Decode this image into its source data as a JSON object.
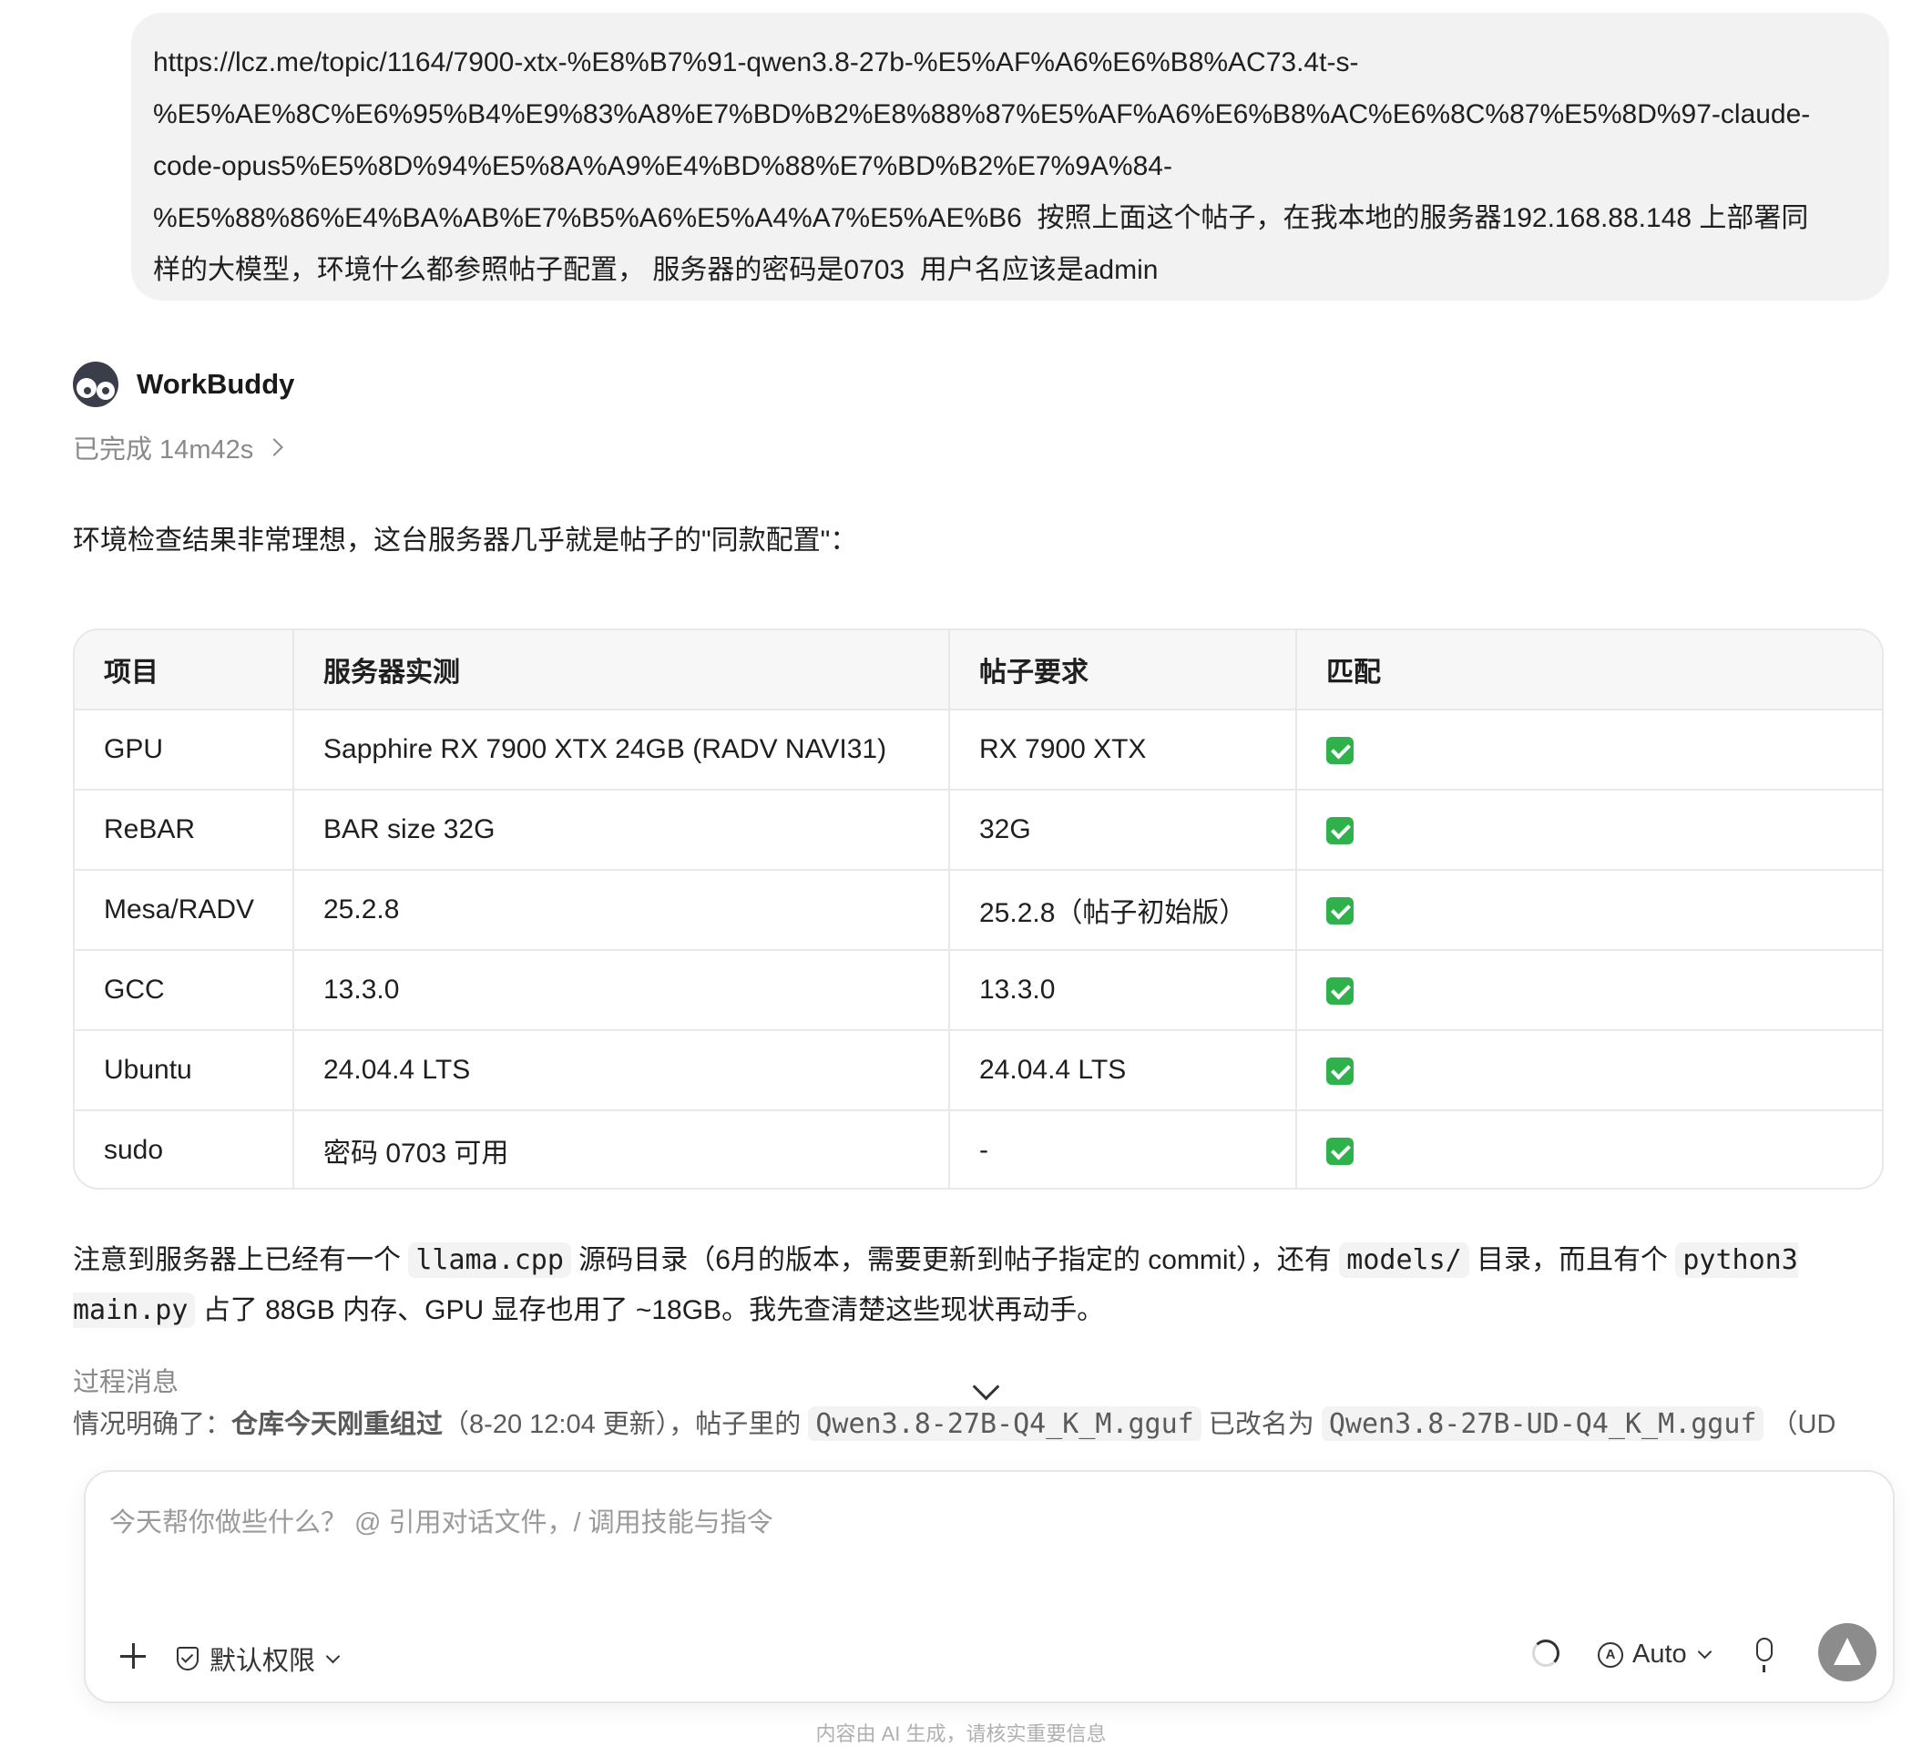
{
  "user_message": {
    "text": "https://lcz.me/topic/1164/7900-xtx-%E8%B7%91-qwen3.8-27b-%E5%AF%A6%E6%B8%AC73.4t-s-\n%E5%AE%8C%E6%95%B4%E9%83%A8%E7%BD%B2%E8%88%87%E5%AF%A6%E6%B8%AC%E6%8C%87%E5%8D%97-claude-\ncode-opus5%E5%8D%94%E5%8A%A9%E4%BD%88%E7%BD%B2%E7%9A%84-\n%E5%88%86%E4%BA%AB%E7%B5%A6%E5%A4%A7%E5%AE%B6  按照上面这个帖子，在我本地的服务器192.168.88.148 上部署同\n样的大模型，环境什么都参照帖子配置， 服务器的密码是0703  用户名应该是admin"
  },
  "assistant": {
    "name": "WorkBuddy",
    "status": "已完成 14m42s",
    "intro": "环境检查结果非常理想，这台服务器几乎就是帖子的\"同款配置\"："
  },
  "table": {
    "headers": [
      "项目",
      "服务器实测",
      "帖子要求",
      "匹配"
    ],
    "rows": [
      {
        "item": "GPU",
        "measured": "Sapphire RX 7900 XTX 24GB (RADV NAVI31)",
        "required": "RX 7900 XTX"
      },
      {
        "item": "ReBAR",
        "measured": "BAR size 32G",
        "required": "32G"
      },
      {
        "item": "Mesa/RADV",
        "measured": "25.2.8",
        "required": "25.2.8（帖子初始版）"
      },
      {
        "item": "GCC",
        "measured": "13.3.0",
        "required": "13.3.0"
      },
      {
        "item": "Ubuntu",
        "measured": "24.04.4 LTS",
        "required": "24.04.4 LTS"
      },
      {
        "item": "sudo",
        "measured": "密码 0703 可用",
        "required": "-"
      }
    ]
  },
  "note": {
    "p1": "注意到服务器上已经有一个 ",
    "c1": "llama.cpp",
    "p2": " 源码目录（6月的版本，需要更新到帖子指定的 commit），还有 ",
    "c2": "models/",
    "p3": " 目录，而且有个 ",
    "c3": "python3 main.py",
    "p4": " 占了 88GB 内存、GPU 显存也用了 ~18GB。我先查清楚这些现状再动手。"
  },
  "process": {
    "label": "过程消息",
    "t1": "情况明确了：",
    "b1": "仓库今天刚重组过",
    "t2": "（8-20 12:04 更新），帖子里的 ",
    "c1": "Qwen3.8-27B-Q4_K_M.gguf",
    "t3": " 已改名为 ",
    "c2": "Qwen3.8-27B-UD-Q4_K_M.gguf",
    "t4": " （UD"
  },
  "composer": {
    "placeholder": "今天帮你做些什么？ @ 引用对话文件，/ 调用技能与指令",
    "permission_label": "默认权限",
    "model_label": "Auto"
  },
  "footer_note": "内容由 AI 生成，请核实重要信息",
  "colors": {
    "check": "#2fb24c",
    "bubble": "#f2f2f2",
    "send": "#8c8c8c"
  }
}
